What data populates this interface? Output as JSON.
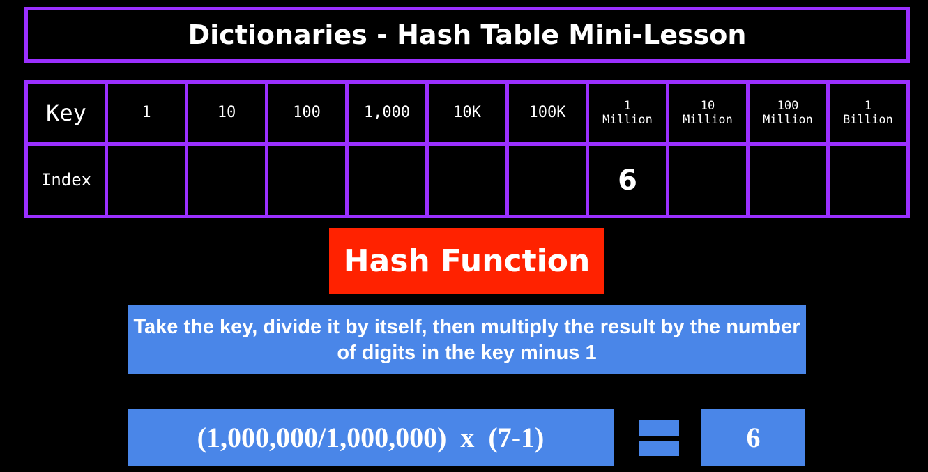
{
  "title": "Dictionaries - Hash Table Mini-Lesson",
  "table": {
    "key_label": "Key",
    "index_label": "Index",
    "keys": [
      [
        "1"
      ],
      [
        "10"
      ],
      [
        "100"
      ],
      [
        "1,000"
      ],
      [
        "10K"
      ],
      [
        "100K"
      ],
      [
        "1",
        "Million"
      ],
      [
        "10",
        "Million"
      ],
      [
        "100",
        "Million"
      ],
      [
        "1",
        "Billion"
      ]
    ],
    "indexes": [
      "",
      "",
      "",
      "",
      "",
      "",
      "6",
      "",
      "",
      ""
    ]
  },
  "hash_function_label": "Hash Function",
  "description": "Take the key, divide it by itself, then multiply the result by the number of digits in the key minus 1",
  "formula": "(1,000,000/1,000,000)  x  (7-1)",
  "equals_symbol": "=",
  "result": "6",
  "colors": {
    "border": "#9b30ff",
    "hash_box": "#ff2200",
    "info_box": "#4a86e8",
    "background": "#000000"
  }
}
